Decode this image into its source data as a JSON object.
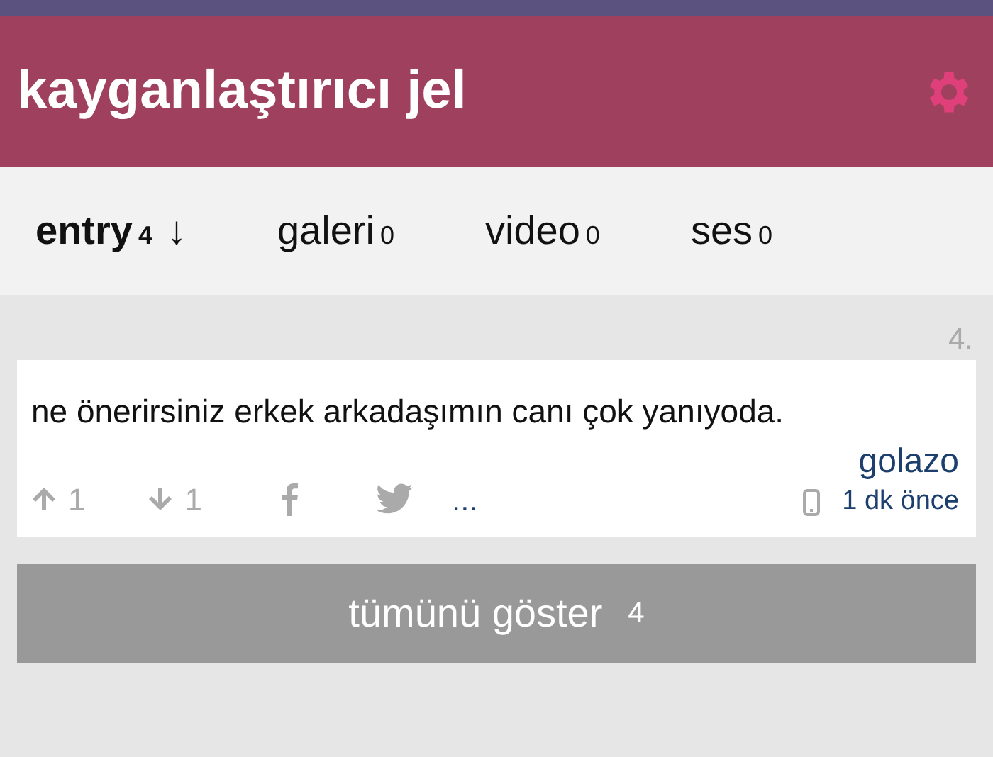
{
  "header": {
    "title": "kayganlaştırıcı jel"
  },
  "tabs": [
    {
      "label": "entry",
      "count": "4",
      "sort_arrow": "↓",
      "selected": true
    },
    {
      "label": "galeri",
      "count": "0",
      "selected": false
    },
    {
      "label": "video",
      "count": "0",
      "selected": false
    },
    {
      "label": "ses",
      "count": "0",
      "selected": false
    }
  ],
  "entry": {
    "number": "4.",
    "text": "ne önerirsiniz erkek arkadaşımın canı çok yanıyoda.",
    "upvotes": "1",
    "downvotes": "1",
    "more": "...",
    "author": "golazo",
    "time": "1 dk önce"
  },
  "show_all_button": {
    "label": "tümünü göster",
    "count": "4"
  }
}
